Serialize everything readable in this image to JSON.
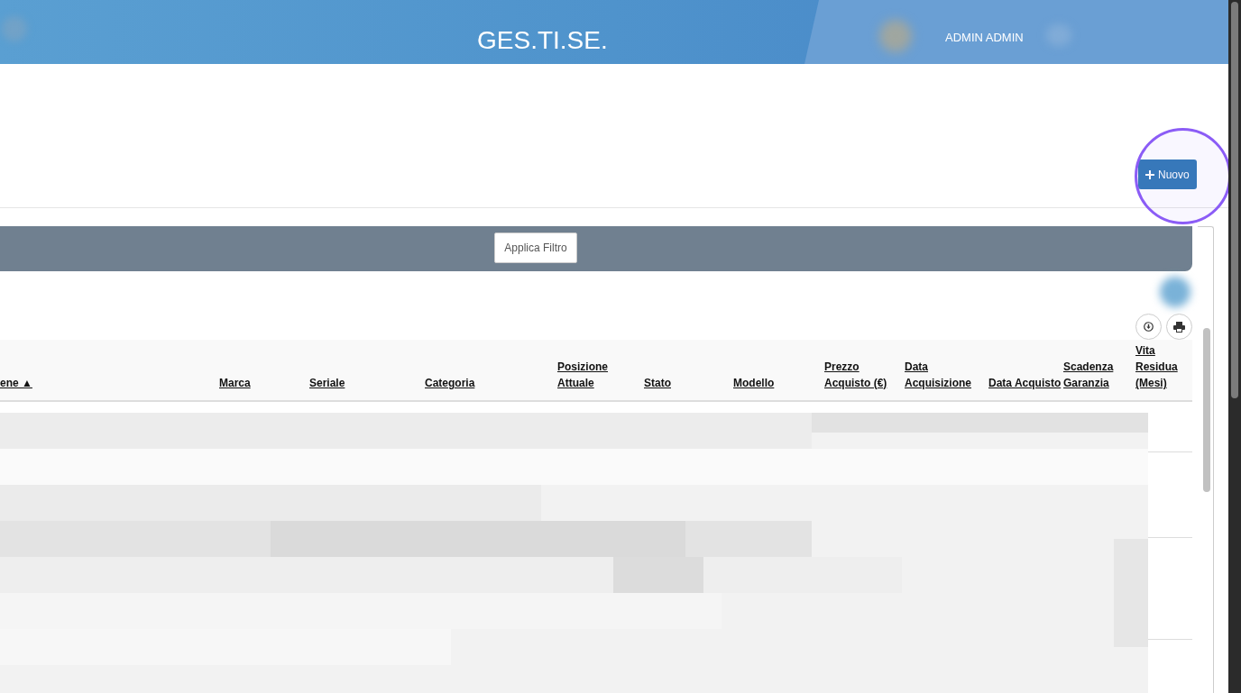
{
  "header": {
    "title": "GES.TI.SE.",
    "user": "ADMIN ADMIN"
  },
  "new_button": {
    "label": "Nuovo"
  },
  "filter_bar": {
    "apply_button": "Applica Filtro"
  },
  "table": {
    "columns": [
      "ene ▲",
      "Marca",
      "Seriale",
      "Categoria",
      "Posizione Attuale",
      "Stato",
      "Modello",
      "Prezzo Acquisto (€)",
      "Data Acquisizione",
      "Data Acquisto",
      "Scadenza Garanzia",
      "Vita Residua (Mesi)"
    ]
  }
}
